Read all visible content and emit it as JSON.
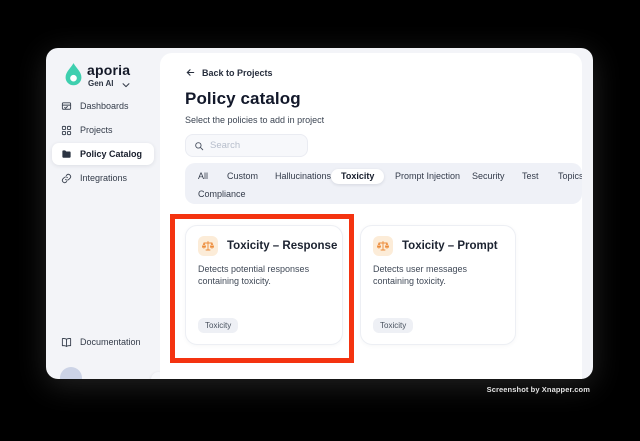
{
  "window": {
    "watermark": "Screenshot by Xnapper.com"
  },
  "colors": {
    "brand_teal": "#3ecfaf",
    "card_icon_orange": "#ec8a38",
    "card_icon_bg": "#fcecd8",
    "annotation_red": "#f43310",
    "sidebar_bg": "#f3f4f8",
    "tabs_bg": "#eff1f7"
  },
  "sidebar": {
    "logo": {
      "brand": "aporia",
      "workspace": "Gen AI",
      "icon": "aporia-drop-icon",
      "chevron_icon": "chevron-down-icon"
    },
    "items": [
      {
        "label": "Dashboards",
        "icon": "dashboards-icon",
        "active": false
      },
      {
        "label": "Projects",
        "icon": "projects-grid-icon",
        "active": false
      },
      {
        "label": "Policy Catalog",
        "icon": "folder-icon",
        "active": true
      },
      {
        "label": "Integrations",
        "icon": "link-icon",
        "active": false
      }
    ],
    "footer_items": [
      {
        "label": "Documentation",
        "icon": "book-icon"
      }
    ]
  },
  "main": {
    "back_link": {
      "label": "Back to Projects",
      "icon": "arrow-left-icon"
    },
    "title": "Policy catalog",
    "subtitle": "Select the policies to add in project",
    "search": {
      "placeholder": "Search",
      "icon": "search-icon"
    },
    "filters": {
      "tabs": [
        "All",
        "Custom",
        "Hallucinations",
        "Toxicity",
        "Prompt Injection",
        "Security",
        "Test",
        "Topics",
        "Compliance"
      ],
      "selected": "Toxicity"
    },
    "cards": [
      {
        "title": "Toxicity – Response",
        "description": "Detects potential responses containing toxicity.",
        "tag": "Toxicity",
        "icon": "scales-icon",
        "highlighted": true
      },
      {
        "title": "Toxicity – Prompt",
        "description": "Detects user messages containing toxicity.",
        "tag": "Toxicity",
        "icon": "scales-icon",
        "highlighted": false
      }
    ]
  }
}
